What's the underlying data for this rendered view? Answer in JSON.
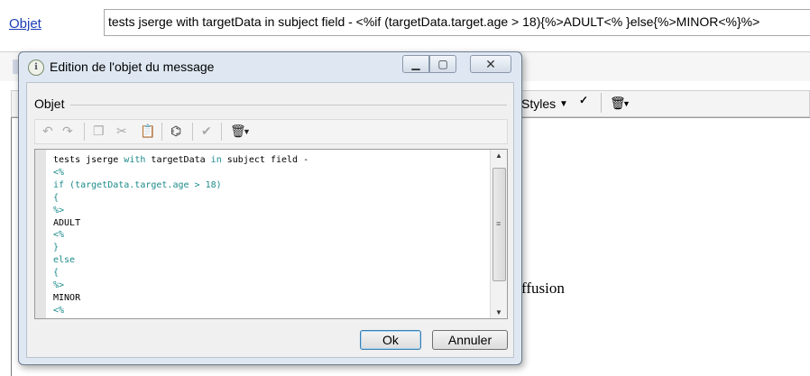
{
  "background": {
    "objet_link": "Objet",
    "subject_value": "tests jserge with targetData in subject field - <%if (targetData.target.age > 18){%>ADULT<% }else{%>MINOR<%}%>",
    "styles_label": "Styles",
    "body_fragment": "ffusion"
  },
  "dialog": {
    "title": "Edition de l'objet du message",
    "group_label": "Objet",
    "ok_label": "Ok",
    "cancel_label": "Annuler"
  },
  "icons": {
    "undo": "undo-icon",
    "redo": "redo-icon",
    "copy": "copy-icon",
    "cut": "cut-icon",
    "paste": "paste-icon",
    "find": "binoculars-icon",
    "check": "check-icon",
    "delete": "trash-icon",
    "spell": "spellcheck-icon"
  },
  "code_lines": [
    "tests jserge with targetData in subject field -",
    "<%",
    "if (targetData.target.age > 18)",
    "{",
    "%>",
    "ADULT",
    "<%",
    "}",
    "else",
    "{",
    "%>",
    "MINOR",
    "<%",
    "}"
  ]
}
